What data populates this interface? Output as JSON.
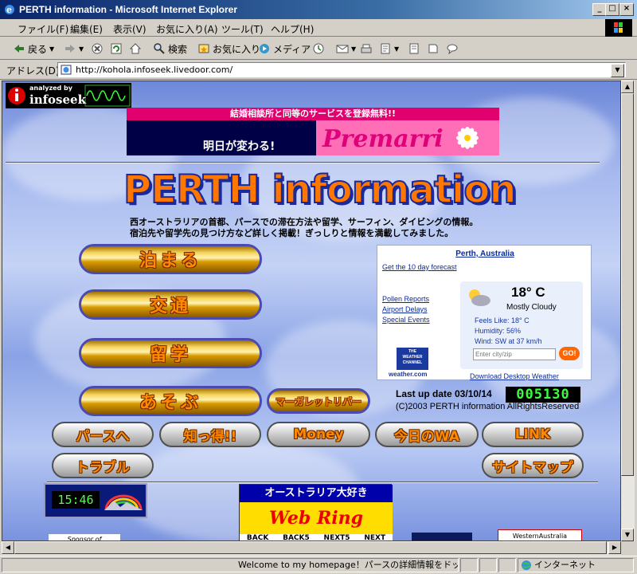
{
  "window": {
    "title": "PERTH  information - Microsoft Internet Explorer",
    "buttons": {
      "minimize": "_",
      "maximize": "□",
      "close": "×"
    }
  },
  "menu": [
    "ファイル(F)",
    "編集(E)",
    "表示(V)",
    "お気に入り(A)",
    "ツール(T)",
    "ヘルプ(H)"
  ],
  "toolbar": {
    "back": "戻る",
    "search": "検索",
    "favorites": "お気に入り",
    "media": "メディア"
  },
  "address": {
    "label": "アドレス(D)",
    "url": "http://kohola.infoseek.livedoor.com/"
  },
  "page": {
    "infoseek_badge": {
      "top": "analyzed by",
      "brand": "infoseek"
    },
    "banner": {
      "top": "結婚相談所と同等のサービスを登録無料!!",
      "left": "明日が変わる!",
      "brand": "Premarri"
    },
    "title": "PERTH information",
    "description_line1": "西オーストラリアの首都、パースでの滞在方法や留学、サーフィン、ダイビングの情報。",
    "description_line2": "宿泊先や留学先の見つけ方など詳しく掲載！ぎっしりと情報を満載してみました。",
    "main_nav": [
      "泊まる",
      "交通",
      "留学",
      "あそぶ"
    ],
    "margaret_river": "マーガレットリバー",
    "sub_nav": [
      "パースへ",
      "知っ得!!",
      "Money",
      "今日のWA",
      "LINK"
    ],
    "trouble": "トラブル",
    "sitemap": "サイトマップ",
    "weather": {
      "city": "Perth, Australia",
      "forecast_link": "Get the 10 day forecast",
      "links": [
        "Pollen Reports",
        "Airport Delays",
        "Special Events"
      ],
      "temperature": "18° C",
      "condition": "Mostly Cloudy",
      "feels_like": "Feels Like: 18° C",
      "humidity": "Humidity: 56%",
      "wind": "Wind: SW at 37 km/h",
      "input_placeholder": "Enter city/zip",
      "go": "GO!",
      "logo_lines": [
        "THE",
        "WEATHER",
        "CHANNEL"
      ],
      "logo_site": "weather.com",
      "download": "Download Desktop Weather"
    },
    "last_update": "Last up date 03/10/14",
    "counter": "005130",
    "copyright": "(C)2003 PERTH information AllRightsReserved",
    "clock_time": "15:46",
    "webring": {
      "top": "オーストラリア大好き",
      "title": "Web Ring",
      "nav": [
        "BACK",
        "BACK5",
        "NEXT5",
        "NEXT"
      ]
    },
    "sponsor": "Sponsor of",
    "western_australia": "WesternAustralia"
  },
  "status": {
    "message": "Welcome to my homepage！パースの詳細情報をドッサリ",
    "zone": "インターネット"
  }
}
